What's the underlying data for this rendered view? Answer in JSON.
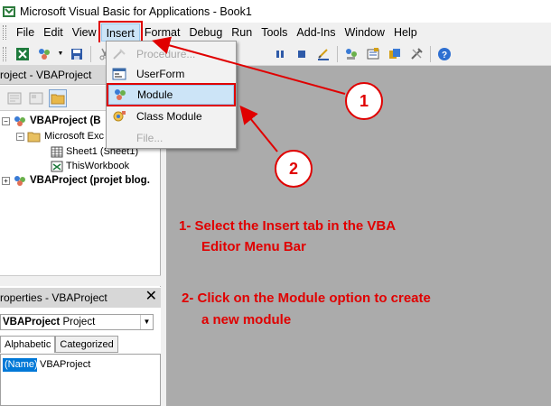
{
  "window": {
    "title": "Microsoft Visual Basic for Applications - Book1"
  },
  "menubar": {
    "items": [
      {
        "label": "File"
      },
      {
        "label": "Edit"
      },
      {
        "label": "View"
      },
      {
        "label": "Insert"
      },
      {
        "label": "Format"
      },
      {
        "label": "Debug"
      },
      {
        "label": "Run"
      },
      {
        "label": "Tools"
      },
      {
        "label": "Add-Ins"
      },
      {
        "label": "Window"
      },
      {
        "label": "Help"
      }
    ],
    "active": "Insert"
  },
  "insert_menu": {
    "items": [
      {
        "label": "Procedure...",
        "enabled": false,
        "icon": "procedure-icon"
      },
      {
        "label": "UserForm",
        "enabled": true,
        "icon": "userform-icon"
      },
      {
        "label": "Module",
        "enabled": true,
        "icon": "module-icon",
        "highlighted": true
      },
      {
        "label": "Class Module",
        "enabled": true,
        "icon": "class-module-icon"
      },
      {
        "label": "File...",
        "enabled": false,
        "icon": ""
      }
    ]
  },
  "project_pane": {
    "title": "roject - VBAProject",
    "tree": [
      {
        "label": "VBAProject (B",
        "bold": true
      },
      {
        "label": "Microsoft Exc"
      },
      {
        "label": "Sheet1 (Sheet1)"
      },
      {
        "label": "ThisWorkbook"
      },
      {
        "label": "VBAProject (projet blog.",
        "bold": true
      }
    ]
  },
  "properties_pane": {
    "title": "roperties - VBAProject",
    "object_name": "VBAProject",
    "object_type": "Project",
    "tabs": [
      "Alphabetic",
      "Categorized"
    ],
    "row": {
      "name": "(Name)",
      "value": "VBAProject"
    }
  },
  "annotations": {
    "step1": "1- Select the Insert tab in the VBA",
    "step1_cont": "Editor Menu Bar",
    "step2": "2- Click on the Module option to create",
    "step2_cont": "a new module",
    "badge1": "1",
    "badge2": "2"
  },
  "colors": {
    "annotation": "#e00000",
    "highlight": "#cce4f7",
    "workspace": "#ababab"
  }
}
